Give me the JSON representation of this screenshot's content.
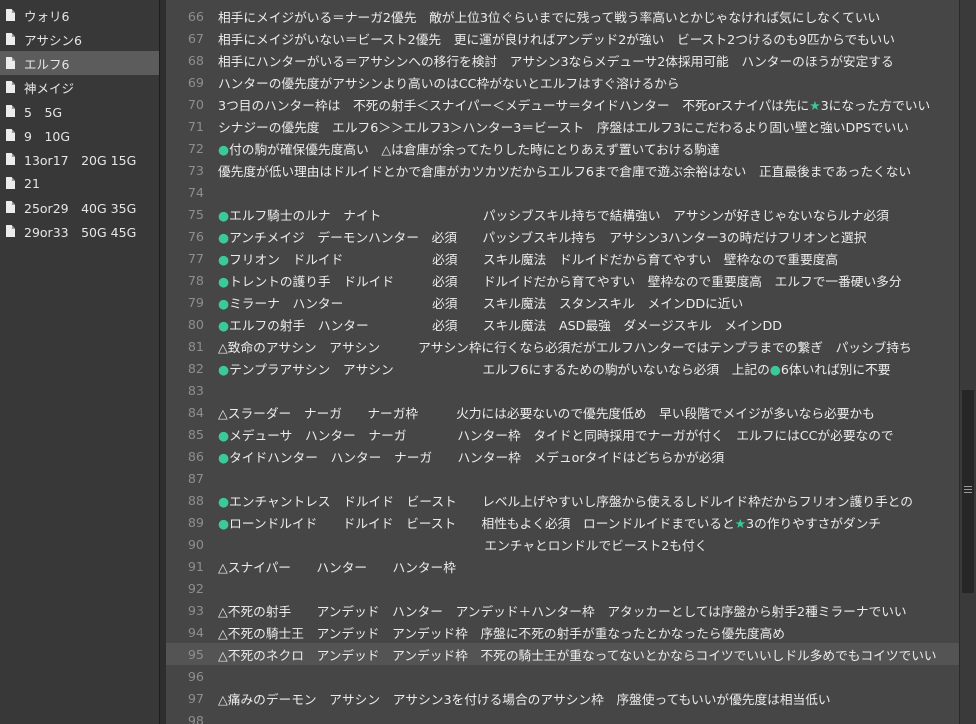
{
  "sidebar": {
    "items": [
      {
        "label": "ウォリ6",
        "active": false
      },
      {
        "label": "アサシン6",
        "active": false
      },
      {
        "label": "エルフ6",
        "active": true
      },
      {
        "label": "神メイジ",
        "active": false
      },
      {
        "label": "5　5G",
        "active": false
      },
      {
        "label": "9　10G",
        "active": false
      },
      {
        "label": "13or17　20G 15G",
        "active": false
      },
      {
        "label": "21",
        "active": false
      },
      {
        "label": "25or29　40G 35G",
        "active": false
      },
      {
        "label": "29or33　50G 45G",
        "active": false
      }
    ]
  },
  "editor": {
    "highlighted_line": "95",
    "lines": [
      {
        "n": "66",
        "t": "相手にメイジがいる＝ナーガ2優先　敵が上位3位ぐらいまでに残って戦う率高いとかじゃなければ気にしなくていい"
      },
      {
        "n": "67",
        "t": "相手にメイジがいない＝ビースト2優先　更に運が良ければアンデッド2が強い　ビースト2つけるのも9匹からでもいい"
      },
      {
        "n": "68",
        "t": "相手にハンターがいる＝アサシンへの移行を検討　アサシン3ならメデューサ2体採用可能　ハンターのほうが安定する"
      },
      {
        "n": "69",
        "t": "ハンターの優先度がアサシンより高いのはCC枠がないとエルフはすぐ溶けるから"
      },
      {
        "n": "70",
        "t": "3つ目のハンター枠は　不死の射手＜スナイパー＜メデューサ＝タイドハンター　不死orスナイパは先に★3になった方でいい"
      },
      {
        "n": "71",
        "t": "シナジーの優先度　エルフ6＞＞エルフ3＞ハンター3＝ビースト　序盤はエルフ3にこだわるより固い壁と強いDPSでいい"
      },
      {
        "n": "72",
        "t": "●付の駒が確保優先度高い　△は倉庫が余ってたりした時にとりあえず置いておける駒達"
      },
      {
        "n": "73",
        "t": "優先度が低い理由はドルイドとかで倉庫がカツカツだからエルフ6まで倉庫で遊ぶ余裕はない　正直最後まであったくない"
      },
      {
        "n": "74",
        "t": ""
      },
      {
        "n": "75",
        "t": "●エルフ騎士のルナ　ナイト　　　　　　　　パッシブスキル持ちで結構強い　アサシンが好きじゃないならルナ必須"
      },
      {
        "n": "76",
        "t": "●アンチメイジ　デーモンハンター　必須　　パッシブスキル持ち　アサシン3ハンター3の時だけフリオンと選択"
      },
      {
        "n": "77",
        "t": "●フリオン　ドルイド　　　　　　　必須　　スキル魔法　ドルイドだから育てやすい　壁枠なので重要度高"
      },
      {
        "n": "78",
        "t": "●トレントの護り手　ドルイド　　　必須　　ドルイドだから育てやすい　壁枠なので重要度高　エルフで一番硬い多分"
      },
      {
        "n": "79",
        "t": "●ミラーナ　ハンター　　　　　　　必須　　スキル魔法　スタンスキル　メインDDに近い"
      },
      {
        "n": "80",
        "t": "●エルフの射手　ハンター　　　　　必須　　スキル魔法　ASD最強　ダメージスキル　メインDD"
      },
      {
        "n": "81",
        "t": "△致命のアサシン　アサシン　　　アサシン枠に行くなら必須だがエルフハンターではテンプラまでの繋ぎ　パッシブ持ち"
      },
      {
        "n": "82",
        "t": "●テンプラアサシン　アサシン　　　　　　　エルフ6にするための駒がいないなら必須　上記の●6体いれば別に不要"
      },
      {
        "n": "83",
        "t": ""
      },
      {
        "n": "84",
        "t": "△スラーダー　ナーガ　　ナーガ枠　　　火力には必要ないので優先度低め　早い段階でメイジが多いなら必要かも"
      },
      {
        "n": "85",
        "t": "●メデューサ　ハンター　ナーガ　　　　ハンター枠　タイドと同時採用でナーガが付く　エルフにはCCが必要なので"
      },
      {
        "n": "86",
        "t": "●タイドハンター　ハンター　ナーガ　　ハンター枠　メデュorタイドはどちらかが必須"
      },
      {
        "n": "87",
        "t": ""
      },
      {
        "n": "88",
        "t": "●エンチャントレス　ドルイド　ビースト　　レベル上げやすいし序盤から使えるしドルイド枠だからフリオン護り手との"
      },
      {
        "n": "89",
        "t": "●ローンドルイド　　ドルイド　ビースト　　相性もよく必須　ローンドルイドまでいると★3の作りやすさがダンチ"
      },
      {
        "n": "90",
        "t": "　　　　　　　　　　　　　　　　　　　　　エンチャとロンドルでビースト2も付く"
      },
      {
        "n": "91",
        "t": "△スナイパー　　ハンター　　ハンター枠"
      },
      {
        "n": "92",
        "t": ""
      },
      {
        "n": "93",
        "t": "△不死の射手　　アンデッド　ハンター　アンデッド＋ハンター枠　アタッカーとしては序盤から射手2種ミラーナでいい"
      },
      {
        "n": "94",
        "t": "△不死の騎士王　アンデッド　アンデッド枠　序盤に不死の射手が重なったとかなったら優先度高め"
      },
      {
        "n": "95",
        "t": "△不死のネクロ　アンデッド　アンデッド枠　不死の騎士王が重なってないとかならコイツでいいしドル多めでもコイツでいい"
      },
      {
        "n": "96",
        "t": ""
      },
      {
        "n": "97",
        "t": "△痛みのデーモン　アサシン　アサシン3を付ける場合のアサシン枠　序盤使ってもいいが優先度は相当低い"
      },
      {
        "n": "98",
        "t": ""
      }
    ]
  },
  "colors": {
    "marker": "#3cc99a",
    "editor_bg": "#464646",
    "sidebar_bg": "#383838"
  }
}
